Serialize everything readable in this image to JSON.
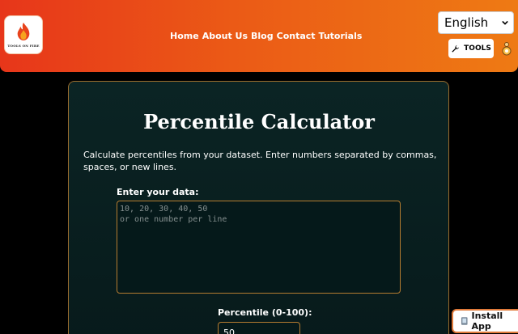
{
  "header": {
    "logo_text": "TOOLS ON FIRE",
    "nav": [
      {
        "label": "Home"
      },
      {
        "label": "About Us"
      },
      {
        "label": "Blog"
      },
      {
        "label": "Contact"
      },
      {
        "label": "Tutorials"
      }
    ],
    "language": "English",
    "tools_label": "TOOLS",
    "icons": {
      "logo": "flame-icon",
      "tools": "wrench-icon",
      "user": "user-icon",
      "dropdown": "chevron-down-icon"
    }
  },
  "main": {
    "title": "Percentile Calculator",
    "description": "Calculate percentiles from your dataset. Enter numbers separated by commas, spaces, or new lines.",
    "data_label": "Enter your data:",
    "data_placeholder": "10, 20, 30, 40, 50\nor one number per line",
    "percentile_label": "Percentile (0-100):",
    "percentile_value": "50"
  },
  "install": {
    "label": "Install App",
    "icon": "install-icon"
  },
  "colors": {
    "header_start": "#e7361a",
    "header_end": "#ee7a14",
    "card_border": "#9a6d2e",
    "card_bg": "#0b2424"
  }
}
